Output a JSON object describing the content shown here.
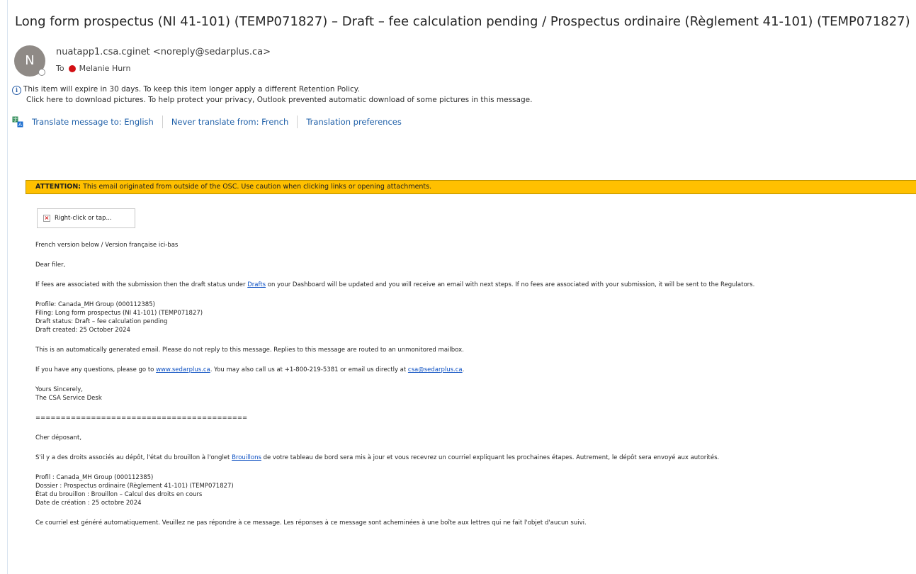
{
  "email": {
    "subject": "Long form prospectus (NI 41-101) (TEMP071827) – Draft – fee calculation pending / Prospectus ordinaire (Règlement 41-101) (TEMP071827)",
    "avatar_initial": "N",
    "sender": "nuatapp1.csa.cginet <noreply@sedarplus.ca>",
    "to_label": "To",
    "recipient": "Melanie Hurn",
    "info_line1": "This item will expire in 30 days. To keep this item longer apply a different Retention Policy.",
    "info_line2": "Click here to download pictures. To help protect your privacy, Outlook prevented automatic download of some pictures in this message.",
    "translate": {
      "translate_to": "Translate message to: English",
      "never_translate": "Never translate from: French",
      "preferences": "Translation preferences"
    },
    "attention_label": "ATTENTION:",
    "attention_text": "This email originated from outside of the OSC. Use caution when clicking links or opening attachments.",
    "image_placeholder": "Right-click or tap..."
  },
  "body": {
    "version_note": "French version below / Version française ici-bas",
    "en": {
      "greeting": "Dear filer,",
      "para1_before": "If fees are associated with the submission then the draft status under ",
      "para1_link": "Drafts",
      "para1_after": " on your Dashboard will be updated and you will receive an email with next steps. If no fees are associated with your submission, it will be sent to the Regulators.",
      "profile": "Profile: Canada_MH Group (000112385)",
      "filing": "Filing: Long form prospectus (NI 41-101) (TEMP071827)",
      "draft_status": "Draft status: Draft – fee calculation pending",
      "draft_created": "Draft created: 25 October 2024",
      "auto_note": "This is an automatically generated email. Please do not reply to this message. Replies to this message are routed to an unmonitored mailbox.",
      "questions_before": "If you have any questions, please go to ",
      "questions_link": "www.sedarplus.ca",
      "questions_middle": ". You may also call us at +1-800-219-5381 or email us directly at ",
      "questions_email": "csa@sedarplus.ca",
      "questions_after": ".",
      "signoff1": "Yours Sincerely,",
      "signoff2": "The CSA Service Desk"
    },
    "divider": "==========================================",
    "fr": {
      "greeting": "Cher déposant,",
      "para1_before": "S'il y a des droits associés au dépôt, l'état du brouillon à l'onglet ",
      "para1_link": "Brouillons",
      "para1_after": " de votre tableau de bord sera mis à jour et vous recevrez un courriel expliquant les prochaines étapes. Autrement, le dépôt sera envoyé aux autorités.",
      "profile": "Profil : Canada_MH Group (000112385)",
      "filing": "Dossier : Prospectus ordinaire (Règlement 41-101) (TEMP071827)",
      "draft_status": "État du brouillon : Brouillon – Calcul des droits en cours",
      "draft_created": "Date de création : 25 octobre 2024",
      "auto_note": "Ce courriel est généré automatiquement. Veuillez ne pas répondre à ce message. Les réponses à ce message sont acheminées à une boîte aux lettres qui ne fait l'objet d'aucun suivi."
    }
  }
}
